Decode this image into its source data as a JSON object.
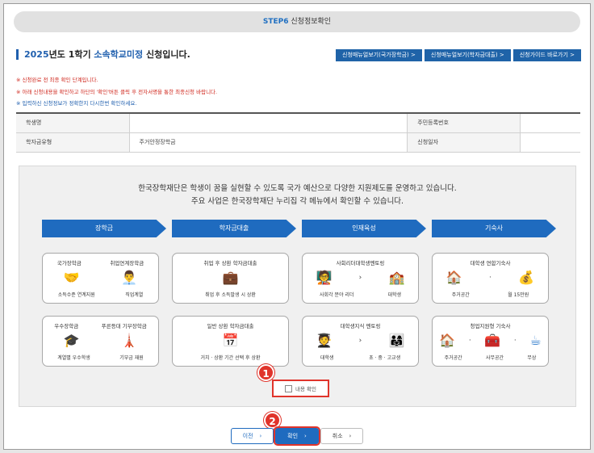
{
  "step": {
    "prefix": "STEP6",
    "title": "신청정보확인"
  },
  "heading": {
    "year": "2025",
    "t1": "년도 1학기 ",
    "school": "소속학교미정",
    "t2": " 신청입니다."
  },
  "top_buttons": [
    {
      "label": "신청매뉴얼보기(국가장학금) >"
    },
    {
      "label": "신청매뉴얼보기(학자금대출) >"
    },
    {
      "label": "신청가이드 바로가기 >"
    }
  ],
  "notes": [
    "※ 신청완료 전 최종 확인 단계입니다.",
    "※ 아래 신청내용을 확인하고 하단의 '확인'버튼 클릭 후 전자서명을 통한 최종신청 바랍니다.",
    "※ 입력하신 신청정보가 정확한지 다시한번 확인하세요."
  ],
  "info_table": {
    "student_label": "학생명",
    "student_value": "",
    "id_label": "주민등록번호",
    "id_value": "",
    "type_label": "학자금유형",
    "type_value": "주거안정장학금",
    "date_label": "신청일자",
    "date_value": ""
  },
  "panel": {
    "line1": "한국장학재단은 학생이 꿈을 실현할 수 있도록 국가 예산으로 다양한 지원제도를 운영하고 있습니다.",
    "line2": "주요 사업은 한국장학재단 누리집 각 메뉴에서 확인할 수 있습니다.",
    "categories": [
      {
        "label": "장학금"
      },
      {
        "label": "학자금대출"
      },
      {
        "label": "인재육성"
      },
      {
        "label": "기숙사"
      }
    ],
    "sch1": {
      "a": "국가장학금",
      "b": "취업연계장학금",
      "la": "소득수준 연계지원",
      "lb": "직업계열"
    },
    "sch2": {
      "a": "우수장학금",
      "b": "푸른등대 기부장학금",
      "la": "계열별 우수학생",
      "lb": "기부금 재원"
    },
    "loan1": {
      "title": "취업 후 상환 학자금대출",
      "label": "취업 후 소득발생 시 상환"
    },
    "loan2": {
      "title": "일반 상환 학자금대출",
      "label": "거치 · 상환 기간 선택 후 상환"
    },
    "tal1": {
      "title": "사회리더대학생멘토링",
      "la": "사회각 분야 리더",
      "lb": "대학생"
    },
    "tal2": {
      "title": "대학생지식 멘토링",
      "la": "대학생",
      "lb": "초 · 중 · 고교생"
    },
    "dorm1": {
      "title": "대학생 연합기숙사",
      "la": "주거공간",
      "lb": "월 15만원"
    },
    "dorm2": {
      "title": "청업지원형 기숙사",
      "la": "주거공간",
      "lb": "사무공간",
      "lc": "무상"
    },
    "confirm_label": "내용 확인"
  },
  "badges": {
    "one": "1",
    "two": "2"
  },
  "buttons": {
    "prev": "이전",
    "ok": "확인",
    "cancel": "취소"
  }
}
